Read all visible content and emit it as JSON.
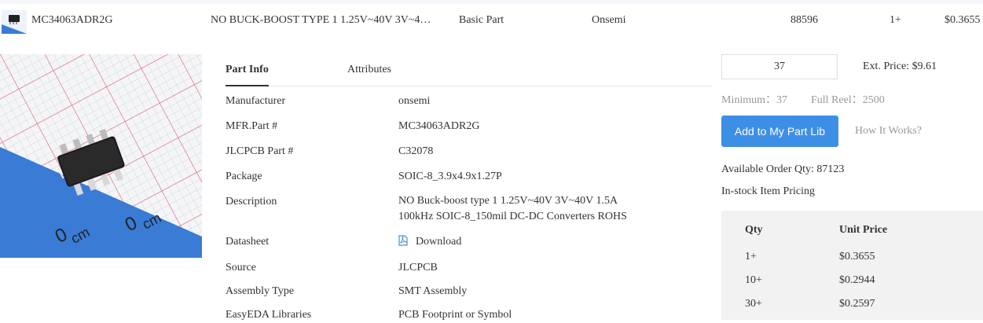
{
  "row": {
    "part_number": "MC34063ADR2G",
    "description": "NO BUCK-BOOST TYPE 1 1.25V~40V 3V~4…",
    "part_type": "Basic Part",
    "manufacturer": "Onsemi",
    "stock": "88596",
    "min_qty": "1+",
    "price": "$0.3655"
  },
  "tabs": [
    "Part Info",
    "Attributes"
  ],
  "info": {
    "manufacturer_label": "Manufacturer",
    "manufacturer_value": "onsemi",
    "mfr_part_label": "MFR.Part #",
    "mfr_part_value": "MC34063ADR2G",
    "jlcpcb_part_label": "JLCPCB Part #",
    "jlcpcb_part_value": "C32078",
    "package_label": "Package",
    "package_value": "SOIC-8_3.9x4.9x1.27P",
    "description_label": "Description",
    "description_line1": "NO Buck-boost type 1 1.25V~40V 3V~40V 1.5A",
    "description_line2": "100kHz SOIC-8_150mil DC-DC Converters ROHS",
    "datasheet_label": "Datasheet",
    "datasheet_link": "Download",
    "source_label": "Source",
    "source_value": "JLCPCB",
    "assembly_label": "Assembly Type",
    "assembly_value": "SMT Assembly",
    "easyeda_label": "EasyEDA Libraries",
    "easyeda_link": "PCB Footprint or Symbol"
  },
  "order": {
    "qty_value": "37",
    "ext_price": "Ext. Price: $9.61",
    "minimum": "Minimum：37",
    "full_reel": "Full Reel：2500",
    "add_button": "Add to My Part Lib",
    "how_it_works": "How It Works?",
    "available_qty": "Available Order Qty: 87123",
    "instock_pricing": "In-stock Item Pricing"
  },
  "price_table": {
    "headers": [
      "Qty",
      "Unit Price"
    ],
    "rows": [
      [
        "1+",
        "$0.3655"
      ],
      [
        "10+",
        "$0.2944"
      ],
      [
        "30+",
        "$0.2597"
      ]
    ]
  },
  "icons": {
    "pdf": "pdf-icon"
  },
  "colors": {
    "link": "#4a90d9",
    "button": "#3d8fe6",
    "pcb_blue": "#3a7bd5"
  }
}
